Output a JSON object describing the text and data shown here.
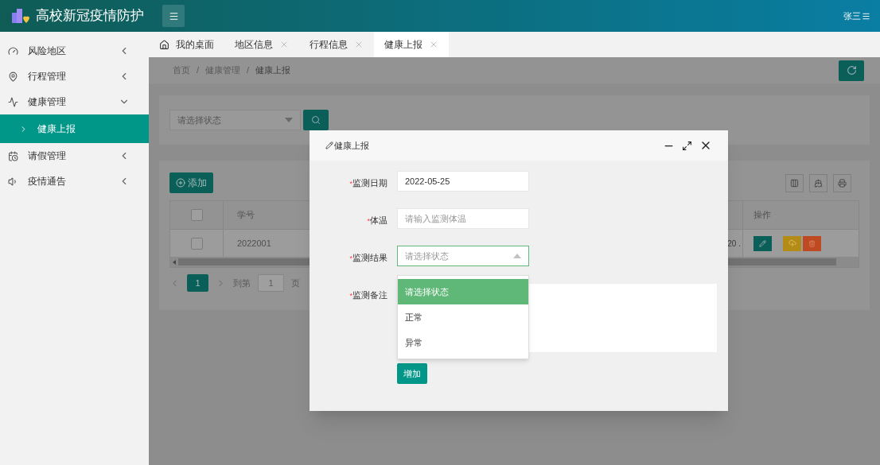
{
  "app": {
    "title": "高校新冠疫情防护"
  },
  "header": {
    "user": "张三"
  },
  "sidebar": {
    "items": [
      {
        "label": "风险地区",
        "expanded": false
      },
      {
        "label": "行程管理",
        "expanded": false
      },
      {
        "label": "健康管理",
        "expanded": true,
        "children": [
          {
            "label": "健康上报",
            "selected": true
          }
        ]
      },
      {
        "label": "请假管理",
        "expanded": false
      },
      {
        "label": "疫情通告",
        "expanded": false
      }
    ]
  },
  "tabs": [
    {
      "label": "我的桌面",
      "kind": "home",
      "selected": false
    },
    {
      "label": "地区信息",
      "kind": "closable",
      "selected": false
    },
    {
      "label": "行程信息",
      "kind": "closable",
      "selected": false
    },
    {
      "label": "健康上报",
      "kind": "closable",
      "selected": true
    }
  ],
  "breadcrumb": {
    "items": [
      "首页",
      "健康管理",
      "健康上报"
    ],
    "separator": "/"
  },
  "search": {
    "placeholder": "请选择状态"
  },
  "table": {
    "add_button": "添加",
    "select_all_checked": false,
    "columns": [
      "学号",
      "操作"
    ],
    "rows": [
      {
        "checked": false,
        "student_id": "2022001",
        "column_3": "20 ."
      }
    ]
  },
  "pagination": {
    "current": "1",
    "goto_label": "到第",
    "goto_value": "1",
    "page_suffix": "页"
  },
  "dialog": {
    "title": "健康上报",
    "fields": [
      {
        "kind": "text",
        "mark": "*",
        "label": "监测日期",
        "value": "2022-05-25"
      },
      {
        "kind": "text",
        "mark": "*",
        "label": "体温",
        "placeholder": "请输入监测体温"
      },
      {
        "kind": "select",
        "mark": "*",
        "label": "监测结果",
        "placeholder": "请选择状态",
        "expanded": true,
        "options": [
          {
            "label": "请选择状态",
            "selected": true
          },
          {
            "label": "正常",
            "selected": false
          },
          {
            "label": "异常",
            "selected": false
          }
        ]
      },
      {
        "kind": "textarea",
        "mark": "*",
        "label": "监测备注"
      }
    ],
    "submit": "增加"
  }
}
